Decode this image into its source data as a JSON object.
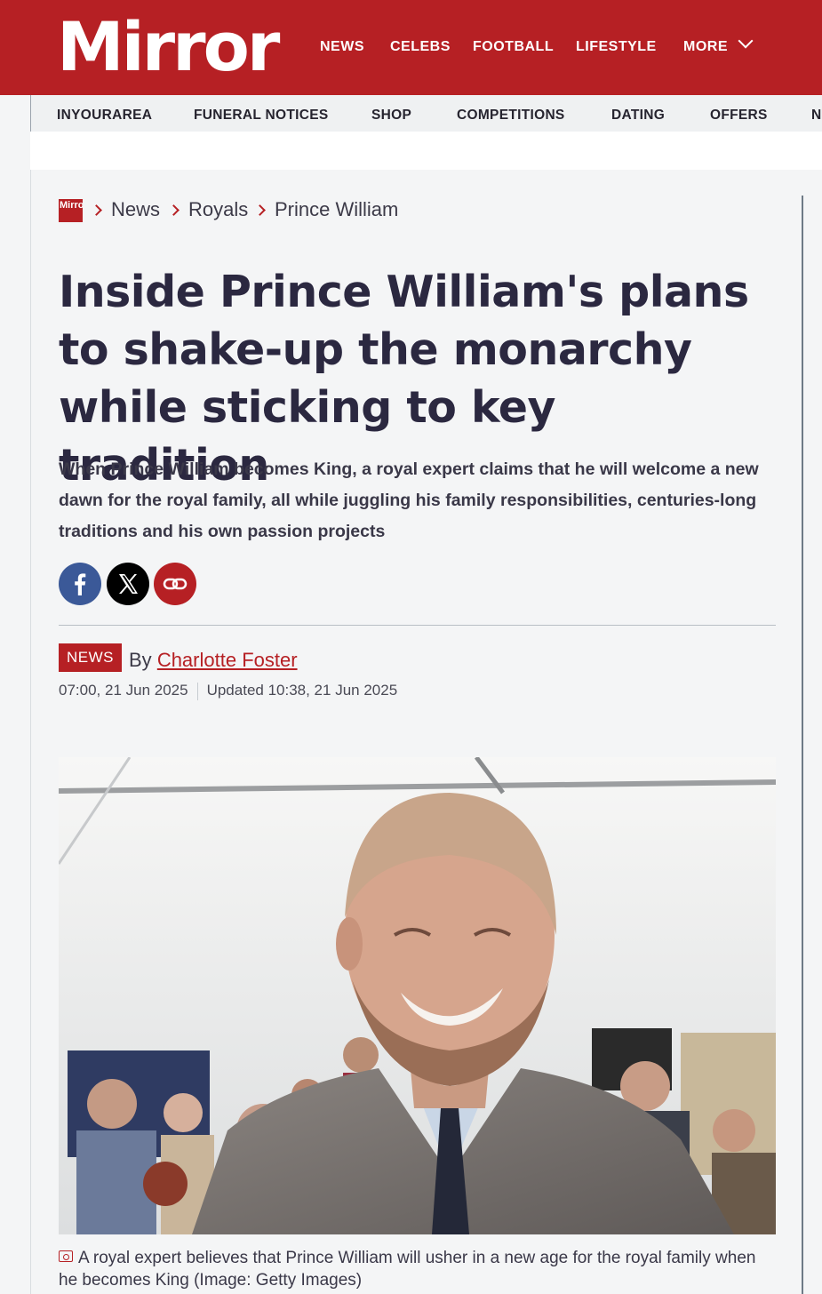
{
  "header": {
    "logo_text": "Mirror",
    "brand_color": "#b62024",
    "nav": [
      {
        "label": "NEWS"
      },
      {
        "label": "CELEBS"
      },
      {
        "label": "FOOTBALL"
      },
      {
        "label": "LIFESTYLE"
      },
      {
        "label": "MORE"
      }
    ],
    "more_icon": "chevron-down-icon"
  },
  "subnav": [
    {
      "label": "INYOURAREA"
    },
    {
      "label": "FUNERAL NOTICES"
    },
    {
      "label": "SHOP"
    },
    {
      "label": "COMPETITIONS"
    },
    {
      "label": "DATING"
    },
    {
      "label": "OFFERS"
    },
    {
      "label": "N"
    }
  ],
  "breadcrumb": {
    "logo_text": "Mirror",
    "items": [
      "News",
      "Royals",
      "Prince William"
    ]
  },
  "article": {
    "title": "Inside Prince William's plans to shake-up the monarchy while sticking to key tradition",
    "standfirst": "When Prince William becomes King, a royal expert claims that he will welcome a new dawn for the royal family, all while juggling his family responsibilities, centuries-long traditions and his own passion projects",
    "share": [
      {
        "icon": "facebook-icon",
        "color": "#3b5998"
      },
      {
        "icon": "x-icon",
        "color": "#000000"
      },
      {
        "icon": "link-icon",
        "color": "#b62024"
      }
    ],
    "badge": "NEWS",
    "by": "By",
    "author": "Charlotte Foster",
    "published": "07:00, 21 Jun 2025",
    "updated": "Updated 10:38, 21 Jun 2025",
    "image_caption": "A royal expert believes that Prince William will usher in a new age for the royal family when he becomes King (Image: Getty Images)",
    "caption_icon": "camera-icon"
  }
}
